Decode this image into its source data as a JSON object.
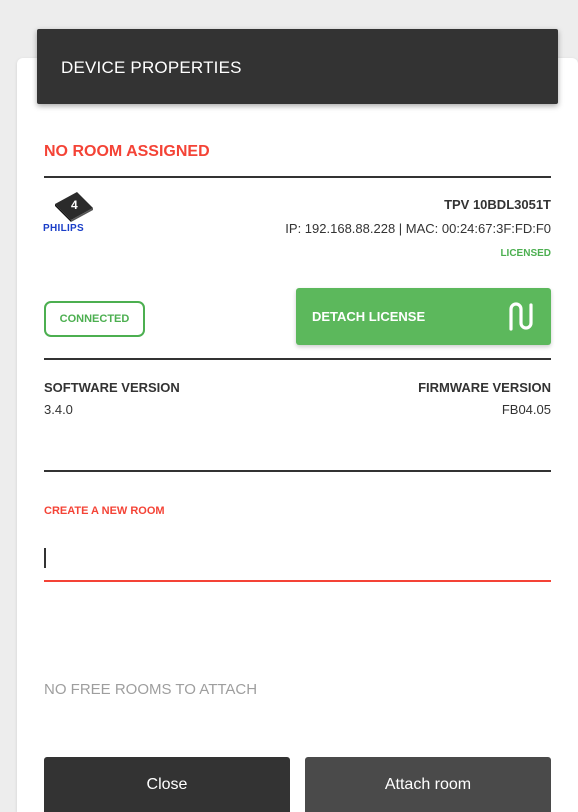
{
  "dialog": {
    "title": "DEVICE PROPERTIES",
    "room_status": "NO ROOM ASSIGNED"
  },
  "device": {
    "logo_badge_number": "4",
    "brand": "PHILIPS",
    "model": "TPV 10BDL3051T",
    "network": "IP: 192.168.88.228 | MAC: 00:24:67:3F:FD:F0",
    "license_status": "LICENSED",
    "connection_status": "CONNECTED",
    "detach_button_label": "DETACH LICENSE",
    "detach_icon": "unlink-magnet-icon",
    "software_version_label": "SOFTWARE VERSION",
    "software_version": "3.4.0",
    "firmware_version_label": "FIRMWARE VERSION",
    "firmware_version": "FB04.05"
  },
  "new_room": {
    "label": "CREATE A NEW ROOM",
    "value": "",
    "placeholder": ""
  },
  "attach": {
    "message": "NO FREE ROOMS TO ATTACH"
  },
  "actions": {
    "close_label": "Close",
    "attach_label": "Attach room"
  },
  "colors": {
    "header_bg": "#333333",
    "error_red": "#f44336",
    "success_green": "#4caf50",
    "button_green": "#5cb85c",
    "dark_button": "#333333"
  }
}
